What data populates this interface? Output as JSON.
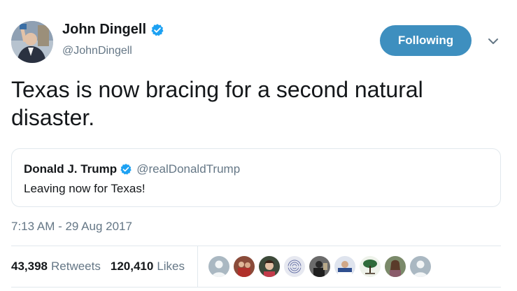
{
  "author": {
    "name": "John Dingell",
    "handle": "@JohnDingell",
    "verified": true,
    "avatar_icon": "profile-photo"
  },
  "follow_button": {
    "label": "Following",
    "color": "#3e8fbf"
  },
  "menu_icon": "chevron-down-icon",
  "tweet": {
    "text": "Texas is now bracing for a second natural disaster."
  },
  "quoted_tweet": {
    "name": "Donald J. Trump",
    "handle": "@realDonaldTrump",
    "verified": true,
    "text": "Leaving now for Texas!"
  },
  "timestamp": "7:13 AM - 29 Aug 2017",
  "stats": {
    "retweets_count": "43,398",
    "retweets_label": "Retweets",
    "likes_count": "120,410",
    "likes_label": "Likes"
  },
  "likers": [
    {
      "icon": "default-avatar",
      "color": "#aab8c2"
    },
    {
      "icon": "user-avatar",
      "color": "#7a3b2e"
    },
    {
      "icon": "user-avatar",
      "color": "#3d4a3a"
    },
    {
      "icon": "fingerprint-logo-avatar",
      "color": "#d8dbe6"
    },
    {
      "icon": "user-avatar",
      "color": "#2b2b2b"
    },
    {
      "icon": "user-avatar",
      "color": "#4a6aa0"
    },
    {
      "icon": "tree-logo-avatar",
      "color": "#e9efe5"
    },
    {
      "icon": "user-avatar",
      "color": "#6b5a4a"
    },
    {
      "icon": "default-avatar",
      "color": "#aab8c2"
    }
  ],
  "colors": {
    "text": "#14171a",
    "secondary": "#657786",
    "border": "#e1e8ed",
    "verified_badge": "#1da1f2"
  }
}
